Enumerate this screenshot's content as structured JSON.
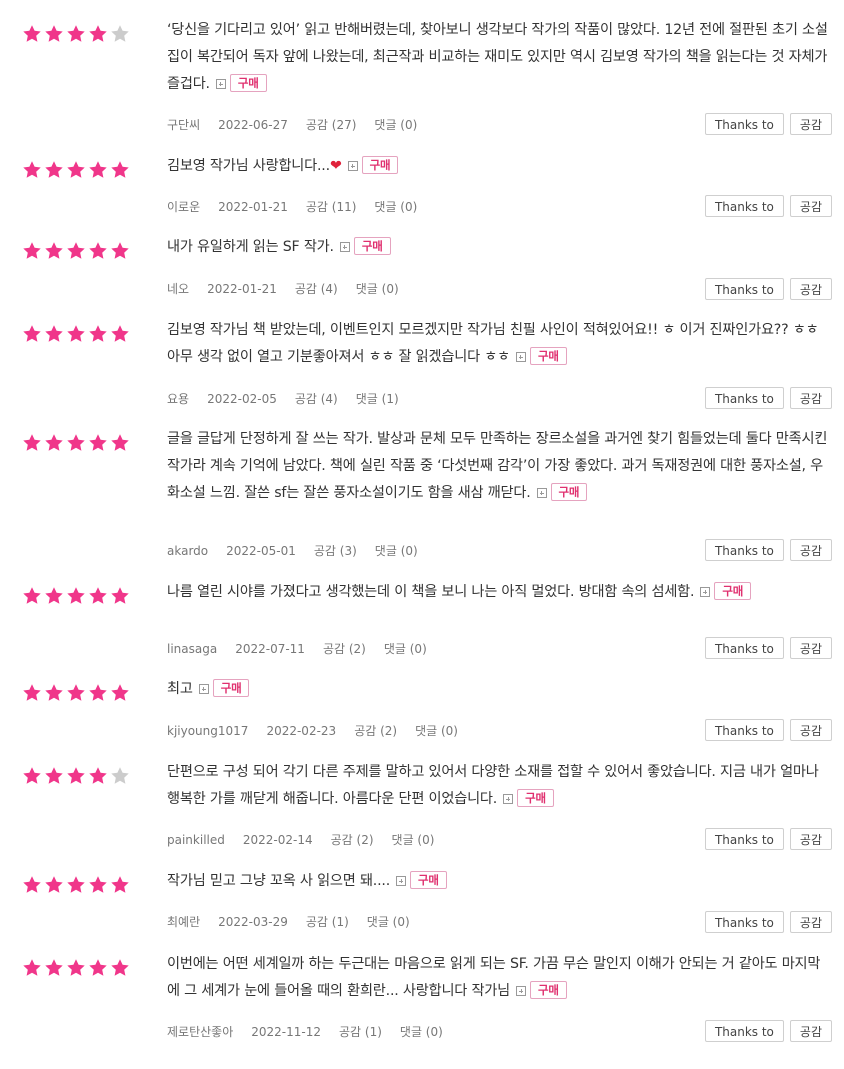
{
  "labels": {
    "buy": "구매",
    "thanks": "Thanks to",
    "like": "공감"
  },
  "colors": {
    "star_on": "#f0368a",
    "star_off": "#cccccc",
    "buy_text": "#e0306f",
    "heart": "#e0223b"
  },
  "reviews": [
    {
      "rating": 4,
      "text": "‘당신을 기다리고 있어’ 읽고 반해버렸는데, 찾아보니 생각보다 작가의 작품이 많았다. 12년 전에 절판된 초기 소설집이 복간되어 독자 앞에 나왔는데, 최근작과 비교하는 재미도 있지만 역시 김보영 작가의 책을 읽는다는 것 자체가 즐겁다.",
      "user": "구단씨",
      "date": "2022-06-27",
      "likes": "공감 (27)",
      "comments": "댓글 (0)"
    },
    {
      "rating": 5,
      "text": "김보영 작가님 사랑합니다...",
      "heart": "❤",
      "user": "이로운",
      "date": "2022-01-21",
      "likes": "공감 (11)",
      "comments": "댓글 (0)"
    },
    {
      "rating": 5,
      "text": "내가 유일하게 읽는 SF 작가.",
      "user": "네오",
      "date": "2022-01-21",
      "likes": "공감 (4)",
      "comments": "댓글 (0)"
    },
    {
      "rating": 5,
      "text": "김보영 작가님 책 받았는데, 이벤트인지 모르겠지만 작가님 친필 사인이 적혀있어요!! ㅎ 이거 진짜인가요?? ㅎㅎ 아무 생각 없이 열고 기분좋아져서 ㅎㅎ 잘 읽겠습니다 ㅎㅎ",
      "user": "요용",
      "date": "2022-02-05",
      "likes": "공감 (4)",
      "comments": "댓글 (1)"
    },
    {
      "rating": 5,
      "text": "글을 글답게 단정하게 잘 쓰는 작가. 발상과 문체 모두 만족하는 장르소설을 과거엔 찾기 힘들었는데 둘다 만족시킨 작가라 계속 기억에 남았다. 책에 실린 작품 중 ‘다섯번째 감각’이 가장 좋았다. 과거 독재정권에 대한 풍자소설, 우화소설 느낌. 잘쓴 sf는 잘쓴 풍자소설이기도 함을 새삼 깨닫다.",
      "user": "akardo",
      "date": "2022-05-01",
      "likes": "공감 (3)",
      "comments": "댓글 (0)"
    },
    {
      "rating": 5,
      "text": "나름 열린 시야를 가졌다고 생각했는데 이 책을 보니 나는 아직 멀었다. 방대함 속의 섬세함.",
      "user": "linasaga",
      "date": "2022-07-11",
      "likes": "공감 (2)",
      "comments": "댓글 (0)"
    },
    {
      "rating": 5,
      "text": "최고",
      "user": "kjiyoung1017",
      "date": "2022-02-23",
      "likes": "공감 (2)",
      "comments": "댓글 (0)"
    },
    {
      "rating": 4,
      "text": "단편으로 구성 되어 각기 다른 주제를 말하고 있어서 다양한 소재를 접할 수 있어서 좋았습니다. 지금 내가 얼마나 행복한 가를 깨닫게 해줍니다. 아름다운 단편 이었습니다.",
      "user": "painkilled",
      "date": "2022-02-14",
      "likes": "공감 (2)",
      "comments": "댓글 (0)"
    },
    {
      "rating": 5,
      "text": "작가님 믿고 그냥 꼬옥 사 읽으면 돼....",
      "user": "최예란",
      "date": "2022-03-29",
      "likes": "공감 (1)",
      "comments": "댓글 (0)"
    },
    {
      "rating": 5,
      "text": "이번에는 어떤 세계일까 하는 두근대는 마음으로 읽게 되는 SF. 가끔 무슨 말인지 이해가 안되는 거 같아도 마지막에 그 세계가 눈에 들어올 때의 환희란... 사랑합니다 작가님",
      "user": "제로탄산좋아",
      "date": "2022-11-12",
      "likes": "공감 (1)",
      "comments": "댓글 (0)"
    }
  ]
}
